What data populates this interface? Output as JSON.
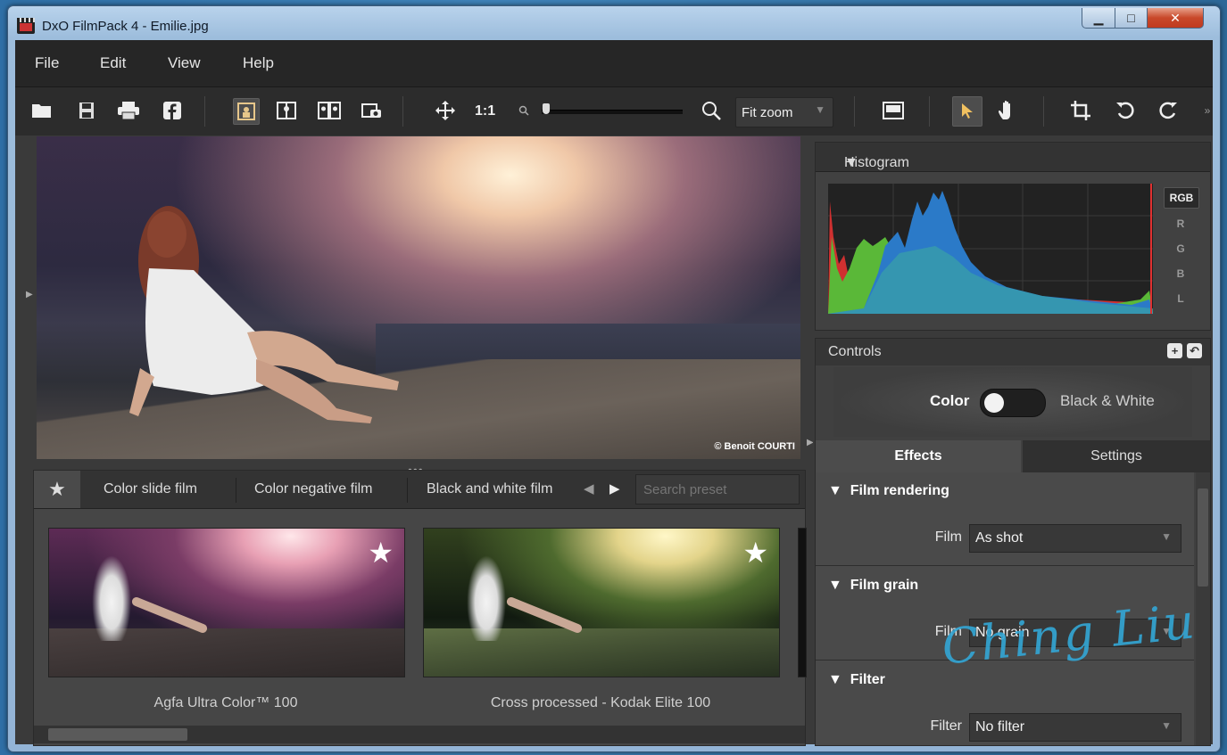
{
  "window": {
    "title": "DxO FilmPack 4 - Emilie.jpg",
    "controls": {
      "minimize": "▁",
      "maximize": "□",
      "close": "✕"
    }
  },
  "menu": [
    "File",
    "Edit",
    "View",
    "Help"
  ],
  "toolbar": {
    "zoom_one_to_one": "1:1",
    "zoom_mode": "Fit zoom",
    "icons": [
      "folder-open-icon",
      "save-icon",
      "print-icon",
      "facebook-icon",
      "single-view-icon",
      "split-view-icon",
      "side-by-side-icon",
      "snapshot-icon",
      "move-icon",
      "zoom-out-icon",
      "zoom-in-icon",
      "preview-icon",
      "select-arrow-icon",
      "hand-icon",
      "crop-icon",
      "rotate-left-icon",
      "rotate-right-icon",
      "more-icon"
    ]
  },
  "photo": {
    "copyright": "© Benoit COURTI"
  },
  "presets": {
    "tabs": [
      "Color slide film",
      "Color negative film",
      "Black and white film"
    ],
    "search_placeholder": "Search preset",
    "items": [
      {
        "label": "Agfa Ultra Color™ 100"
      },
      {
        "label": "Cross processed - Kodak Elite 100"
      }
    ]
  },
  "histogram": {
    "title": "Histogram",
    "channels": [
      "RGB",
      "R",
      "G",
      "B",
      "L"
    ],
    "selected_channel": "RGB"
  },
  "controls": {
    "title": "Controls",
    "toggle_left": "Color",
    "toggle_right": "Black & White",
    "toggle_state": "Color",
    "tabs": [
      "Effects",
      "Settings"
    ],
    "active_tab": "Effects",
    "sections": [
      {
        "title": "Film rendering",
        "field": "Film",
        "value": "As shot"
      },
      {
        "title": "Film grain",
        "field": "Film",
        "value": "No grain"
      },
      {
        "title": "Filter",
        "field": "Filter",
        "value": "No filter"
      }
    ]
  },
  "watermark": "Ching Liu"
}
